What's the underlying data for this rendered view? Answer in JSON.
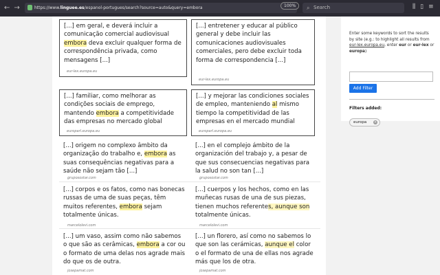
{
  "browser": {
    "url_prefix": "https://www.",
    "url_domain": "linguee.es",
    "url_path": "/espanol-portugues/search?source=auto&query=embora",
    "zoom": "100%",
    "search_placeholder": "Search",
    "icons": [
      "back-icon",
      "forward-icon",
      "reload-icon",
      "lock-icon",
      "bookmark-icon",
      "library-icon",
      "sidebar-icon",
      "menu-icon"
    ]
  },
  "results": [
    {
      "left": {
        "before": "[...] em geral, e deverá incluir a comunicação comercial audiovisual ",
        "hl": "embora",
        "after": " deva excluir qualquer forma de correspondência privada, como mensagens [...]",
        "source": "eur-lex.europa.eu"
      },
      "right": {
        "before": "[...] entretener y educar al público general y debe incluir las comunicaciones audiovisuales comerciales, pero debe excluir toda forma de correspondencia [...]",
        "hl": "",
        "after": "",
        "source": "eur-lex.europa.eu"
      }
    },
    {
      "left": {
        "before": "[...] familiar, como melhorar as condições sociais de emprego, mantendo ",
        "hl": "embora",
        "after": " a competitividade das empresas no mercado global",
        "source": "europarl.europa.eu"
      },
      "right": {
        "before": "[...] y mejorar las condiciones sociales de empleo, manteniendo ",
        "hl": "al",
        "after": " mismo tiempo la competitividad de las empresas en el mercado mundial",
        "source": "europarl.europa.eu"
      }
    },
    {
      "left": {
        "before": "[...] origem no complexo âmbito da organização do trabalho e, ",
        "hl": "embora",
        "after": " as suas consequências negativas para a saúde não sejam tão [...]",
        "source": "gruposostar.com"
      },
      "right": {
        "before": "[...] en el complejo ámbito de la organización del trabajo y, a pesar de que sus consecuencias negativas para la salud no son tan [...]",
        "hl": "",
        "after": "",
        "source": "gruposostar.com"
      }
    },
    {
      "left": {
        "before": "[...] corpos e os fatos, como nas bonecas russas de uma de suas peças, têm muitos referentes, ",
        "hl": "embora",
        "after": " sejam totalmente únicas.",
        "source": "marcelolevi.com"
      },
      "right": {
        "before": "[...] cuerpos y los hechos, como en las muñecas rusas de una de sus piezas, tienen muchos referente",
        "hl": "s, aunque son",
        "after": " totalmente únicas.",
        "source": "marcelolevi.com"
      }
    },
    {
      "left": {
        "before": "[...] um vaso, assim como não sabemos o que são as cerâmicas, ",
        "hl": "embora",
        "after": " a cor ou o formato de uma delas nos agrade mais do que os de outra.",
        "source": "josepamat.com"
      },
      "right": {
        "before": "[...] un florero, así como no sabemos lo que son las cerámicas, ",
        "hl": "aunque el",
        "after": " color o el formato de una de ellas nos agrade más que los de otra.",
        "source": "josepamat.com"
      }
    }
  ],
  "panel": {
    "instruction_1": "Enter some keywords to sort the results by site (e.g.: to highlight all results from ",
    "instruction_link": "eur-lex.europa.eu",
    "instruction_2": ", enter ",
    "instruction_b1": "eur",
    "instruction_3": " or ",
    "instruction_b2": "eur-lex",
    "instruction_4": " or ",
    "instruction_b3": "europa",
    "instruction_5": ")",
    "input_value": "",
    "add_button": "Add Filter",
    "filters_label": "Filters added:",
    "chip_label": "europa",
    "chip_close": "×"
  },
  "colors": {
    "accent": "#1a73e8",
    "highlight": "#fff3a0",
    "toolbar": "#2b2a33"
  }
}
